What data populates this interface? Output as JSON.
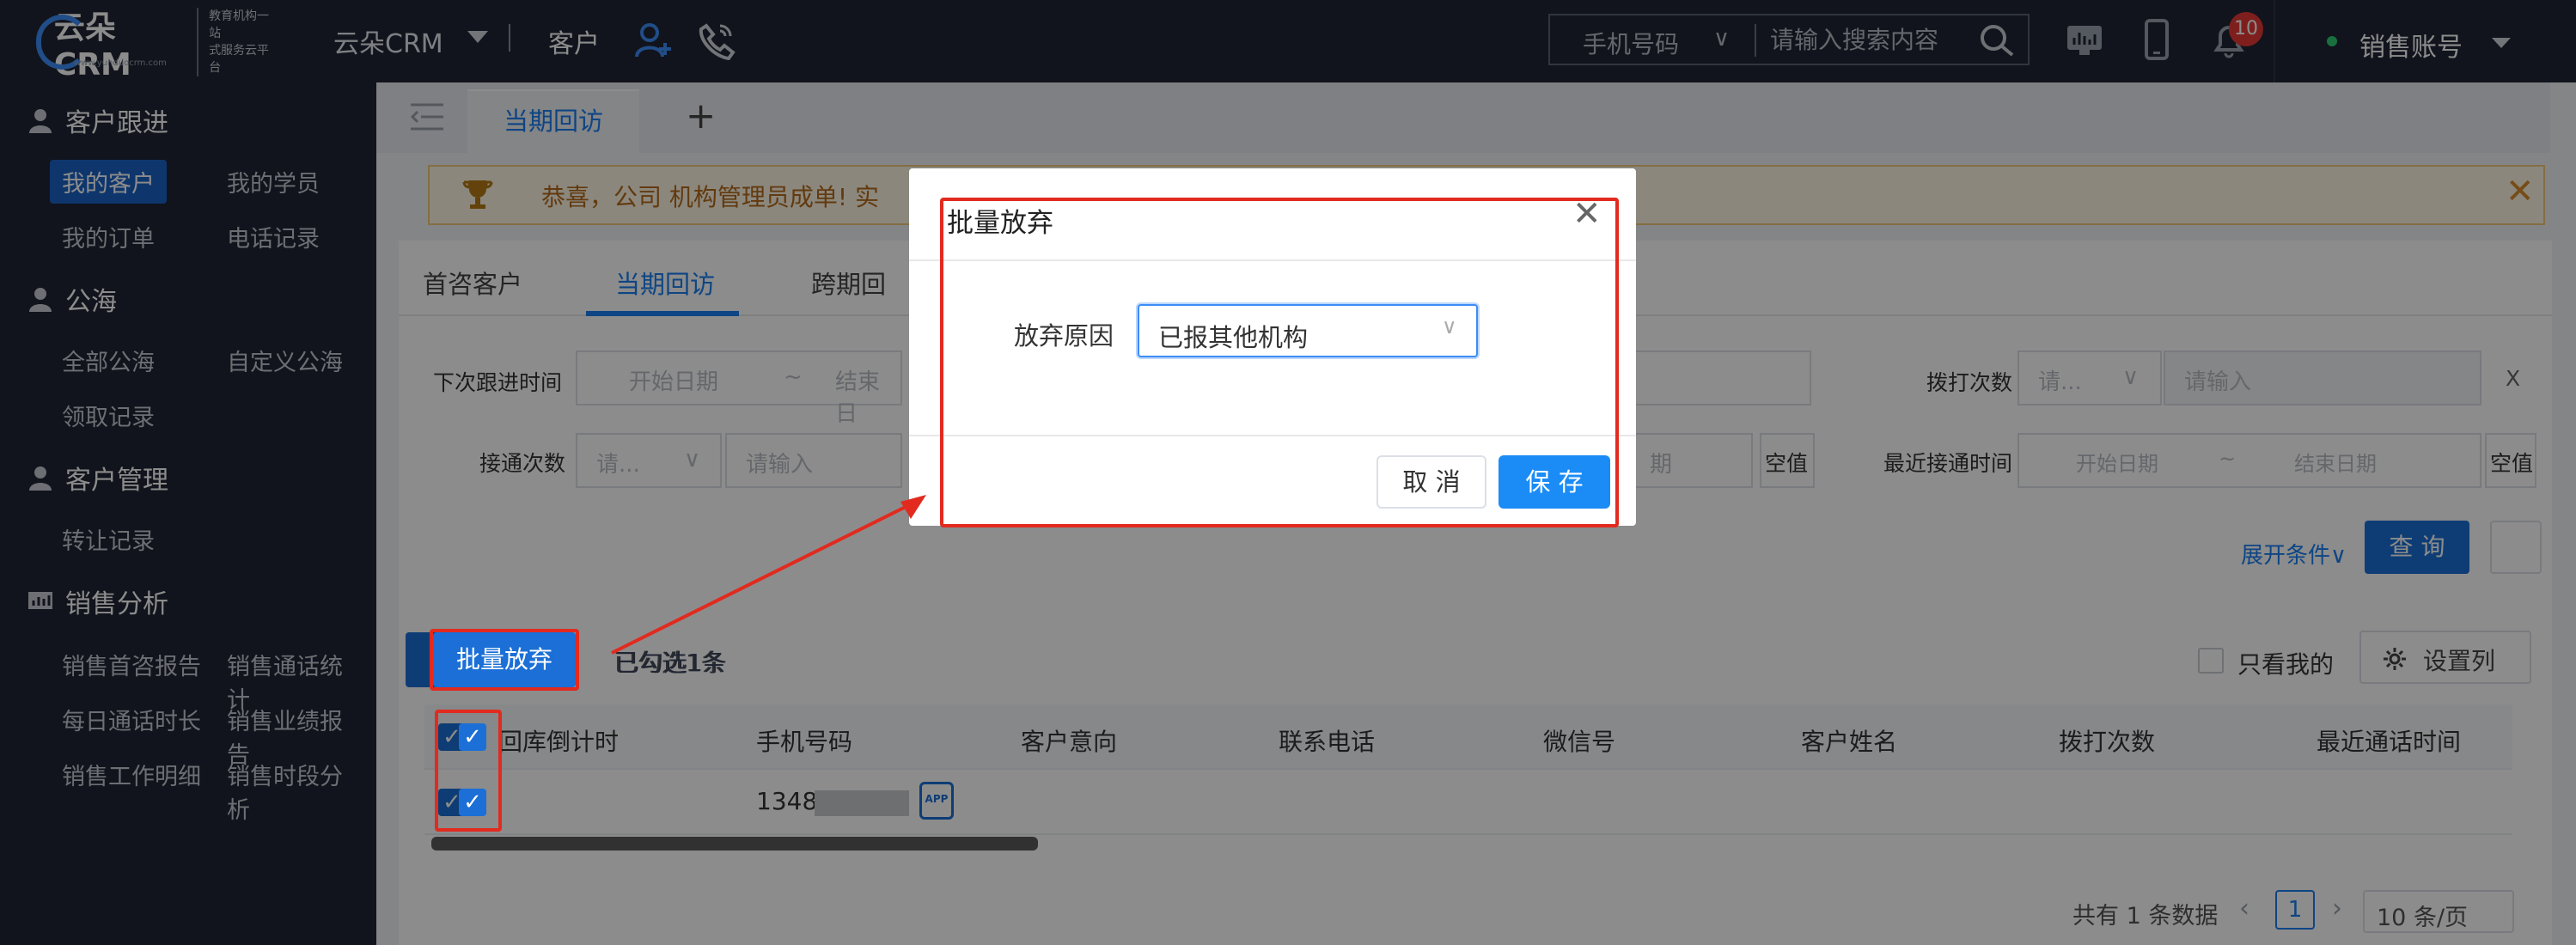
{
  "header": {
    "logo_text": "云朵CRM",
    "logo_sub_line1": "教育机构一站",
    "logo_sub_line2": "式服务云平台",
    "logo_url": "www.yunduocrm.com",
    "product": "云朵CRM",
    "module": "客户",
    "search": {
      "select": "手机号码",
      "placeholder": "请输入搜索内容"
    },
    "notification_count": "10",
    "account": "销售账号"
  },
  "sidebar": {
    "groups": [
      {
        "label": "客户跟进",
        "items": [
          "我的客户",
          "我的学员",
          "我的订单",
          "电话记录"
        ]
      },
      {
        "label": "公海",
        "items": [
          "全部公海",
          "自定义公海",
          "领取记录"
        ]
      },
      {
        "label": "客户管理",
        "items": [
          "转让记录"
        ]
      },
      {
        "label": "销售分析",
        "items": [
          "销售首咨报告",
          "销售通话统计",
          "每日通话时长",
          "销售业绩报告",
          "销售工作明细",
          "销售时段分析"
        ]
      }
    ],
    "active_item": "我的客户"
  },
  "tabbar": {
    "active_tab": "当期回访",
    "add": "+"
  },
  "notice": {
    "text": "恭喜，公司  机构管理员成单!   实"
  },
  "subtabs": [
    "首咨客户",
    "当期回访",
    "跨期回"
  ],
  "filters": {
    "next_followup_label": "下次跟进时间",
    "start_date": "开始日期",
    "tilde": "~",
    "end_date": "结束日",
    "dial_count_label": "拨打次数",
    "select_placeholder": "请...",
    "input_placeholder": "请输入",
    "connect_count_label": "接通次数",
    "date_end_partial": "期",
    "empty_value": "空值",
    "last_connect_label": "最近接通时间",
    "end_date_full": "结束日期",
    "empty_partial": "空值",
    "x_mark": "X",
    "expand": "展开条件∨",
    "query": "查 询"
  },
  "toolbar": {
    "batch_abandon": "批量放弃",
    "selected": "已勾选1条",
    "only_mine": "只看我的",
    "set_columns": "设置列"
  },
  "table": {
    "columns": [
      "回库倒计时",
      "手机号码",
      "客户意向",
      "联系电话",
      "微信号",
      "客户姓名",
      "拨打次数",
      "最近通话时间"
    ],
    "rows": [
      {
        "phone": "1348"
      }
    ],
    "app_tag": "APP"
  },
  "pagination": {
    "total": "共有 1 条数据",
    "current_page": "1",
    "page_size": "10 条/页"
  },
  "modal": {
    "title": "批量放弃",
    "reason_label": "放弃原因",
    "reason_value": "已报其他机构",
    "cancel": "取 消",
    "save": "保 存"
  },
  "colors": {
    "header_bg": "#1f2533",
    "accent": "#1b7ff0",
    "highlight_red": "#e22a1f"
  }
}
